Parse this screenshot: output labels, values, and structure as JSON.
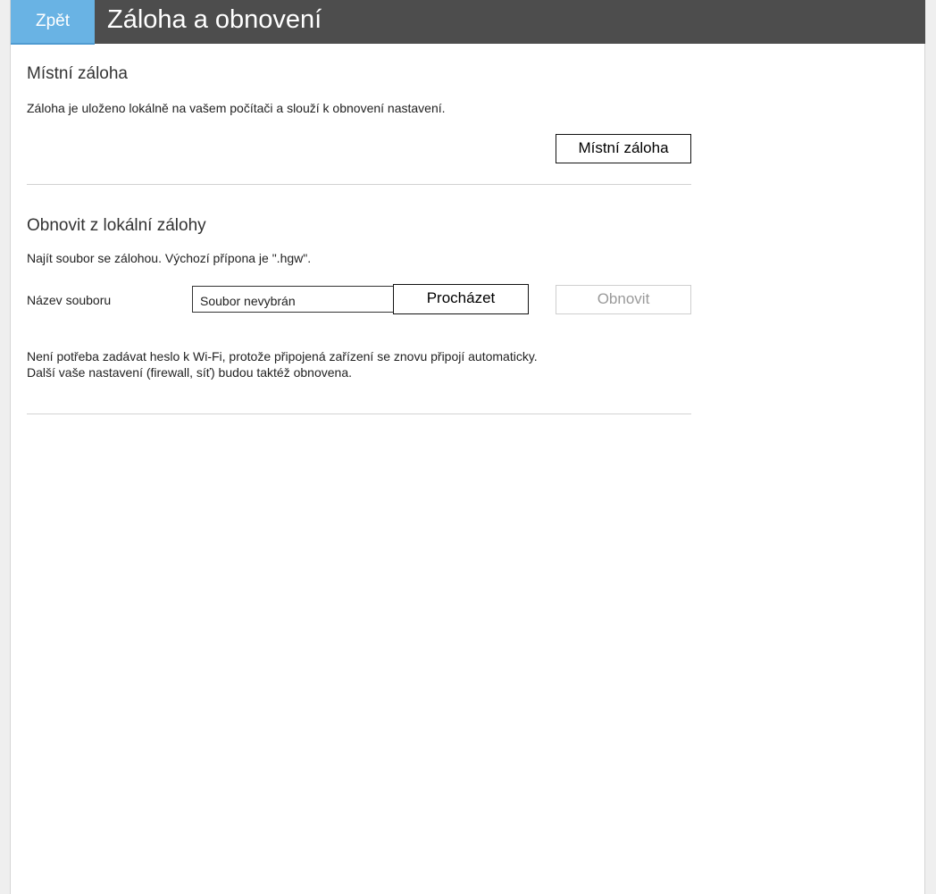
{
  "header": {
    "back_label": "Zpět",
    "title": "Záloha a obnovení"
  },
  "local_backup": {
    "title": "Místní záloha",
    "description": "Záloha je uloženo lokálně na vašem počítači a slouží k obnovení nastavení.",
    "button_label": "Místní záloha"
  },
  "restore": {
    "title": "Obnovit z lokální zálohy",
    "description": "Najít soubor se zálohou. Výchozí přípona je \".hgw\".",
    "file_label": "Název souboru",
    "file_value": "Soubor nevybrán",
    "browse_label": "Procházet",
    "restore_label": "Obnovit",
    "note_line1": "Není potřeba zadávat heslo k Wi-Fi, protože připojená zařízení se znovu připojí automaticky.",
    "note_line2": "Další vaše nastavení (firewall, síť) budou taktéž obnovena."
  },
  "colors": {
    "header_bg": "#4d4d4d",
    "back_button_bg": "#69b3e4"
  }
}
